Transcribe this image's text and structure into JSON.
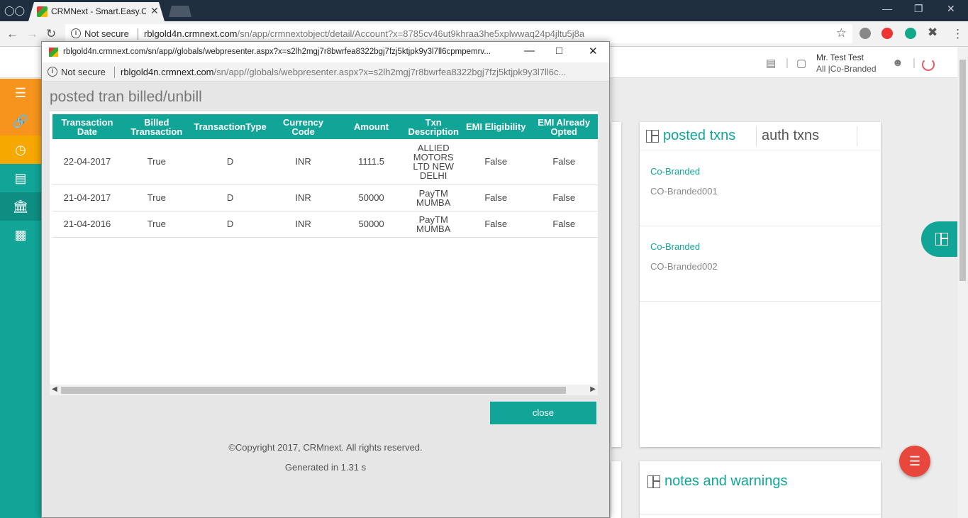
{
  "browser": {
    "tab_title": "CRMNext - Smart.Easy.Co",
    "not_secure": "Not secure",
    "url_host": "rblgold4n.crmnext.com",
    "url_path": "/sn/app/crmnextobject/detail/Account?x=8785cv46ut9khraa3he5xplwwaq24p4jltu5j8a",
    "icons": [
      "incognito-icon",
      "back-icon",
      "forward-icon",
      "reload-icon",
      "star-icon",
      "close-icon",
      "minimize-icon",
      "restore-icon"
    ]
  },
  "header": {
    "user_name": "Mr. Test Test",
    "user_sub": "All |Co-Branded"
  },
  "sidebar": {
    "items": [
      "menu-icon",
      "link-icon",
      "clock-icon",
      "document-icon",
      "bank-icon",
      "briefcase-icon"
    ]
  },
  "posted_panel": {
    "tab_active": "posted txns",
    "tab_inactive": "auth txns",
    "records": [
      {
        "link": "Co-Branded",
        "sub": "CO-Branded001"
      },
      {
        "link": "Co-Branded",
        "sub": "CO-Branded002"
      }
    ]
  },
  "notes_panel": {
    "title": "notes and warnings"
  },
  "popup": {
    "window_title": "rblgold4n.crmnext.com/sn/app//globals/webpresenter.aspx?x=s2lh2mgj7r8bwrfea8322bgj7fzj5ktjpk9y3l7ll6cpmpemrv...",
    "not_secure": "Not secure",
    "url_host": "rblgold4n.crmnext.com",
    "url_path": "/sn/app//globals/webpresenter.aspx?x=s2lh2mgj7r8bwrfea8322bgj7fzj5ktjpk9y3l7ll6c...",
    "heading": "posted tran billed/unbill",
    "columns": [
      "Transaction Date",
      "Billed Transaction",
      "TransactionType",
      "Currency Code",
      "Amount",
      "Txn Description",
      "EMI Eligibility",
      "EMI Already Opted"
    ],
    "rows": [
      [
        "22-04-2017",
        "True",
        "D",
        "INR",
        "1111.5",
        "ALLIED MOTORS LTD NEW DELHI",
        "False",
        "False"
      ],
      [
        "21-04-2017",
        "True",
        "D",
        "INR",
        "50000",
        "PayTM MUMBA",
        "False",
        "False"
      ],
      [
        "21-04-2016",
        "True",
        "D",
        "INR",
        "50000",
        "PayTM MUMBA",
        "False",
        "False"
      ]
    ],
    "close_label": "close",
    "copyright": "©Copyright 2017, CRMnext. All rights reserved.",
    "generated": "Generated in 1.31 s"
  }
}
